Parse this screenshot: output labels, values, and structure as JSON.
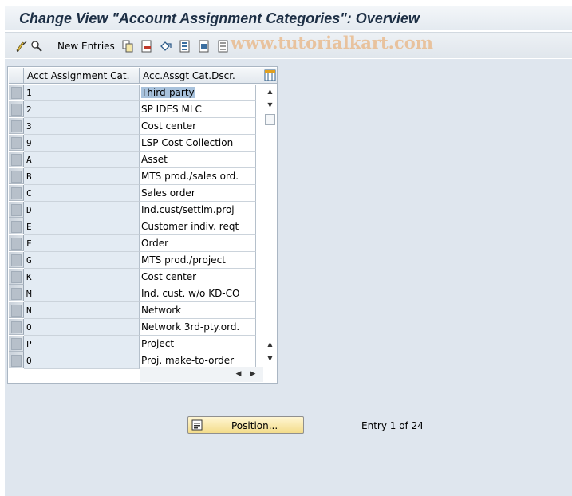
{
  "window": {
    "title": "Change View \"Account Assignment Categories\": Overview"
  },
  "toolbar": {
    "new_entries_label": "New Entries",
    "watermark": "www.tutorialkart.com",
    "icons": [
      "edit-display-icon",
      "copy-icon",
      "delete-icon",
      "undo-icon",
      "select-all-icon",
      "select-block-icon",
      "deselect-all-icon"
    ]
  },
  "table": {
    "columns": [
      "Acct Assignment Cat.",
      "Acc.Assgt Cat.Dscr."
    ],
    "rows": [
      {
        "cat": "1",
        "desc": "Third-party",
        "selected": true
      },
      {
        "cat": "2",
        "desc": "SP IDES MLC"
      },
      {
        "cat": "3",
        "desc": "Cost center"
      },
      {
        "cat": "9",
        "desc": "LSP Cost Collection"
      },
      {
        "cat": "A",
        "desc": "Asset"
      },
      {
        "cat": "B",
        "desc": "MTS prod./sales ord."
      },
      {
        "cat": "C",
        "desc": "Sales order"
      },
      {
        "cat": "D",
        "desc": "Ind.cust/settlm.proj"
      },
      {
        "cat": "E",
        "desc": "Customer indiv. reqt"
      },
      {
        "cat": "F",
        "desc": "Order"
      },
      {
        "cat": "G",
        "desc": "MTS prod./project"
      },
      {
        "cat": "K",
        "desc": "Cost center"
      },
      {
        "cat": "M",
        "desc": "Ind. cust. w/o KD-CO"
      },
      {
        "cat": "N",
        "desc": "Network"
      },
      {
        "cat": "O",
        "desc": "Network 3rd-pty.ord."
      },
      {
        "cat": "P",
        "desc": "Project"
      },
      {
        "cat": "Q",
        "desc": "Proj. make-to-order"
      }
    ]
  },
  "footer": {
    "position_button_label": "Position...",
    "entry_info": "Entry 1 of 24"
  },
  "colors": {
    "content_bg": "#dfe6ee",
    "key_column_bg": "#e3ebf3",
    "button_yellow": "#f3dc8a",
    "selection": "#a8c2dc"
  }
}
